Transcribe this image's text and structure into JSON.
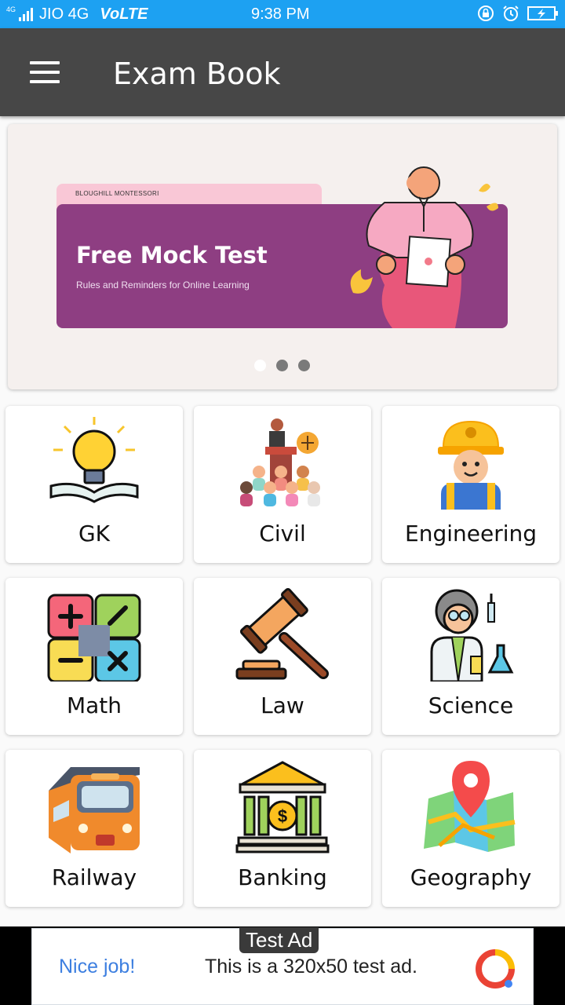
{
  "status": {
    "network": "4G",
    "carrier": "JIO 4G",
    "volte": "VoLTE",
    "time": "9:38 PM"
  },
  "appbar": {
    "title": "Exam Book"
  },
  "banner": {
    "tag": "BLOUGHILL MONTESSORI",
    "headline": "Free Mock Test",
    "subtitle": "Rules and Reminders for Online Learning",
    "slides": 3,
    "active_slide": 1
  },
  "categories": [
    {
      "label": "GK",
      "icon": "lightbulb-book-icon"
    },
    {
      "label": "Civil",
      "icon": "courtroom-icon"
    },
    {
      "label": "Engineering",
      "icon": "engineer-helmet-icon"
    },
    {
      "label": "Math",
      "icon": "calculator-icon"
    },
    {
      "label": "Law",
      "icon": "gavel-icon"
    },
    {
      "label": "Science",
      "icon": "scientist-icon"
    },
    {
      "label": "Railway",
      "icon": "train-icon"
    },
    {
      "label": "Banking",
      "icon": "bank-icon"
    },
    {
      "label": "Geography",
      "icon": "map-pin-icon"
    }
  ],
  "ad": {
    "tag": "Test Ad",
    "cta": "Nice job!",
    "text": "This is a 320x50 test ad."
  },
  "colors": {
    "status_bar": "#1da1f2",
    "app_bar": "#474747",
    "banner_purple": "#8e3e82",
    "ad_link": "#3d7fe0"
  }
}
